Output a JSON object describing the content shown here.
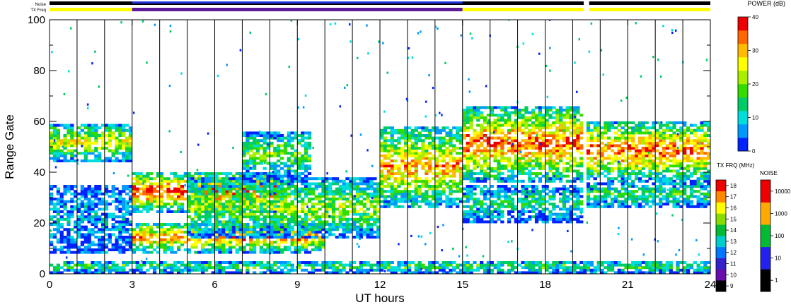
{
  "chart_data": {
    "type": "heatmap",
    "title": "",
    "xlabel": "UT hours",
    "ylabel": "Range Gate",
    "xlim": [
      0,
      24
    ],
    "ylim": [
      0,
      100
    ],
    "x_ticks": [
      "0",
      "3",
      "6",
      "9",
      "12",
      "15",
      "18",
      "21",
      "24"
    ],
    "y_ticks": [
      "0",
      "20",
      "40",
      "60",
      "80",
      "100"
    ],
    "top_strips": {
      "noise_label": "Noise",
      "txfreq_label": "TX Freq"
    },
    "colorbars": [
      {
        "title": "POWER (dB)",
        "ticks": [
          "0",
          "10",
          "20",
          "30",
          "40"
        ],
        "range": [
          0,
          40
        ],
        "colors": [
          "#0022ff",
          "#0099ff",
          "#00dddd",
          "#00cc66",
          "#33dd00",
          "#aaee00",
          "#ffff00",
          "#ffbb00",
          "#ff6600",
          "#ee0000"
        ]
      },
      {
        "title": "TX FRQ (MHz)",
        "ticks": [
          "9",
          "10",
          "11",
          "12",
          "13",
          "14",
          "15",
          "16",
          "17",
          "18"
        ],
        "colors": [
          "#000000",
          "#6a0dad",
          "#3322cc",
          "#0077ff",
          "#00cccc",
          "#00bb33",
          "#88dd00",
          "#ffff00",
          "#ff8800",
          "#ee0000"
        ]
      },
      {
        "title": "NOISE",
        "ticks": [
          "1",
          "10",
          "100",
          "1000",
          "10000"
        ],
        "colors": [
          "#000000",
          "#2222ee",
          "#00bb33",
          "#ffaa00",
          "#ee0000"
        ]
      }
    ],
    "echo_bands": [
      {
        "t0": 0,
        "t1": 3,
        "g0": 44,
        "g1": 59,
        "peak": 0.65
      },
      {
        "t0": 0,
        "t1": 3,
        "g0": 8,
        "g1": 35,
        "peak": 0.2
      },
      {
        "t0": 3,
        "t1": 8.5,
        "g0": 24,
        "g1": 40,
        "peak": 0.95
      },
      {
        "t0": 3,
        "t1": 10,
        "g0": 8,
        "g1": 20,
        "peak": 0.85
      },
      {
        "t0": 5,
        "t1": 12,
        "g0": 14,
        "g1": 38,
        "peak": 0.55
      },
      {
        "t0": 7,
        "t1": 9.5,
        "g0": 38,
        "g1": 56,
        "peak": 0.5
      },
      {
        "t0": 12,
        "t1": 15,
        "g0": 26,
        "g1": 58,
        "peak": 0.8
      },
      {
        "t0": 15,
        "t1": 19.3,
        "g0": 36,
        "g1": 66,
        "peak": 0.9
      },
      {
        "t0": 15,
        "t1": 19.3,
        "g0": 20,
        "g1": 35,
        "peak": 0.35
      },
      {
        "t0": 19.5,
        "t1": 24,
        "g0": 36,
        "g1": 60,
        "peak": 0.9
      },
      {
        "t0": 19.5,
        "t1": 24,
        "g0": 26,
        "g1": 36,
        "peak": 0.4
      },
      {
        "t0": 0,
        "t1": 24,
        "g0": 0,
        "g1": 5,
        "peak": 0.4
      }
    ]
  }
}
